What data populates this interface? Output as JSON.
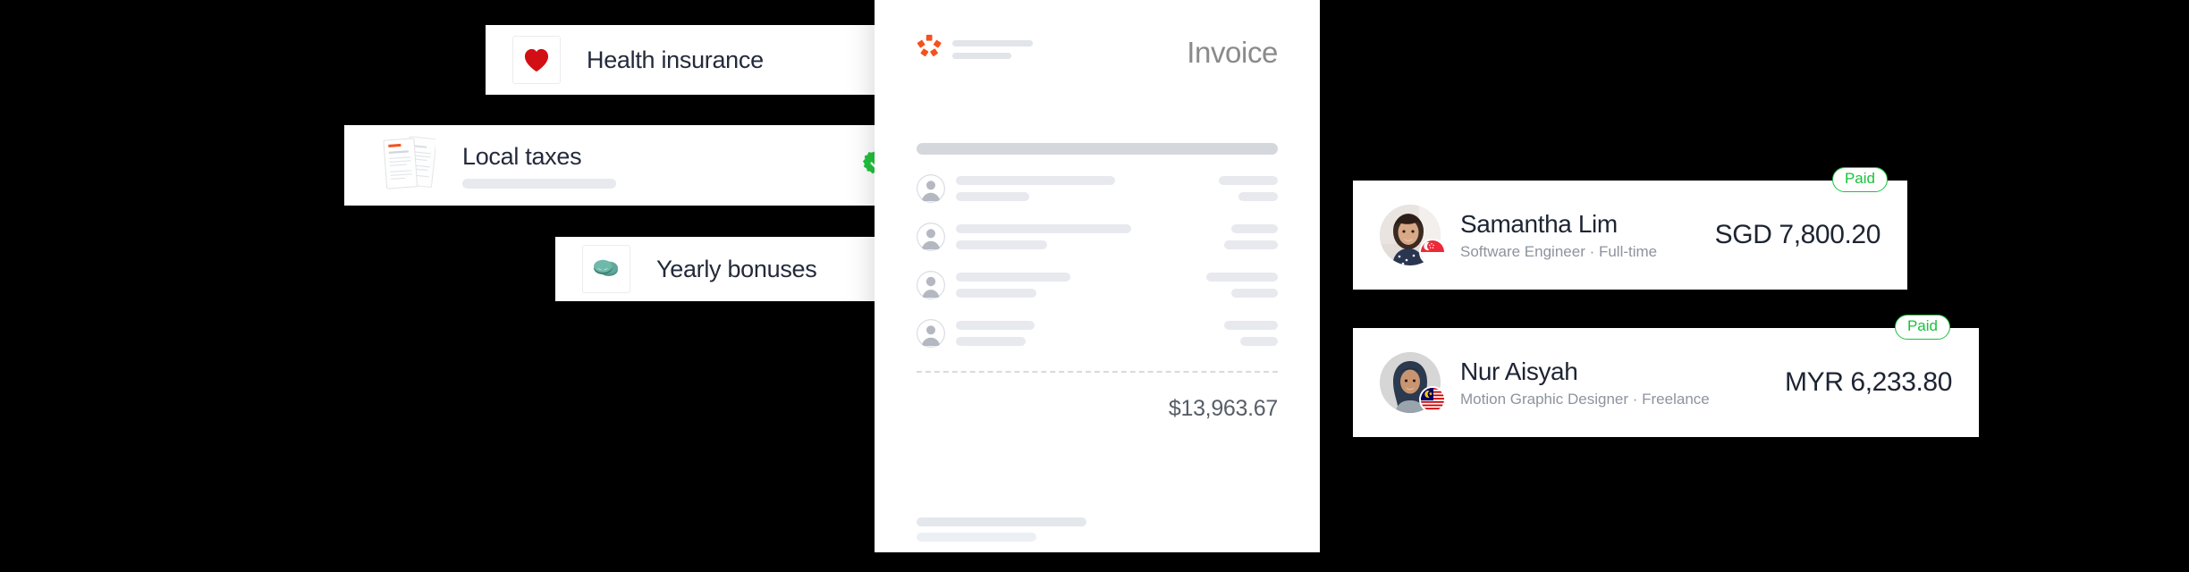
{
  "colors": {
    "brand_orange": "#F4511E",
    "check_green": "#22C33D",
    "paid_green": "#19C23C",
    "skeleton": "#E7E9EE",
    "text_dark": "#1D2433",
    "text_muted": "#8D939D"
  },
  "feature_cards": [
    {
      "id": "health-insurance",
      "title": "Health insurance",
      "icon": "heart-icon",
      "status_icon": "verified-check-icon",
      "has_skeleton_subtitle": false
    },
    {
      "id": "local-taxes",
      "title": "Local taxes",
      "icon": "documents-icon",
      "status_icon": "verified-check-icon",
      "has_skeleton_subtitle": true
    },
    {
      "id": "yearly-bonuses",
      "title": "Yearly bonuses",
      "icon": "coins-icon",
      "status_icon": "verified-check-icon",
      "has_skeleton_subtitle": false
    }
  ],
  "invoice": {
    "logo_icon": "deel-flower-logo-icon",
    "title": "Invoice",
    "header_placeholder_lines": [
      180,
      120
    ],
    "section_bar_width": "100%",
    "line_items": [
      {
        "avatar": "person-avatar-icon",
        "primary_w": 178,
        "secondary_w": 82,
        "amount_w": 66,
        "subamount_w": 44
      },
      {
        "avatar": "person-avatar-icon",
        "primary_w": 196,
        "secondary_w": 102,
        "amount_w": 52,
        "subamount_w": 60
      },
      {
        "avatar": "person-avatar-icon",
        "primary_w": 128,
        "secondary_w": 90,
        "amount_w": 80,
        "subamount_w": 52
      },
      {
        "avatar": "person-avatar-icon",
        "primary_w": 88,
        "secondary_w": 78,
        "amount_w": 60,
        "subamount_w": 42
      }
    ],
    "total": "$13,963.67",
    "footer_lines": [
      190,
      134
    ]
  },
  "people": [
    {
      "id": "samantha-lim",
      "name": "Samantha Lim",
      "role": "Software Engineer · Full-time",
      "amount": "SGD 7,800.20",
      "status": "Paid",
      "flag": "singapore-flag-icon",
      "avatar": "samantha-lim-avatar"
    },
    {
      "id": "nur-aisyah",
      "name": "Nur Aisyah",
      "role": "Motion Graphic Designer · Freelance",
      "amount": "MYR 6,233.80",
      "status": "Paid",
      "flag": "malaysia-flag-icon",
      "avatar": "nur-aisyah-avatar"
    }
  ]
}
